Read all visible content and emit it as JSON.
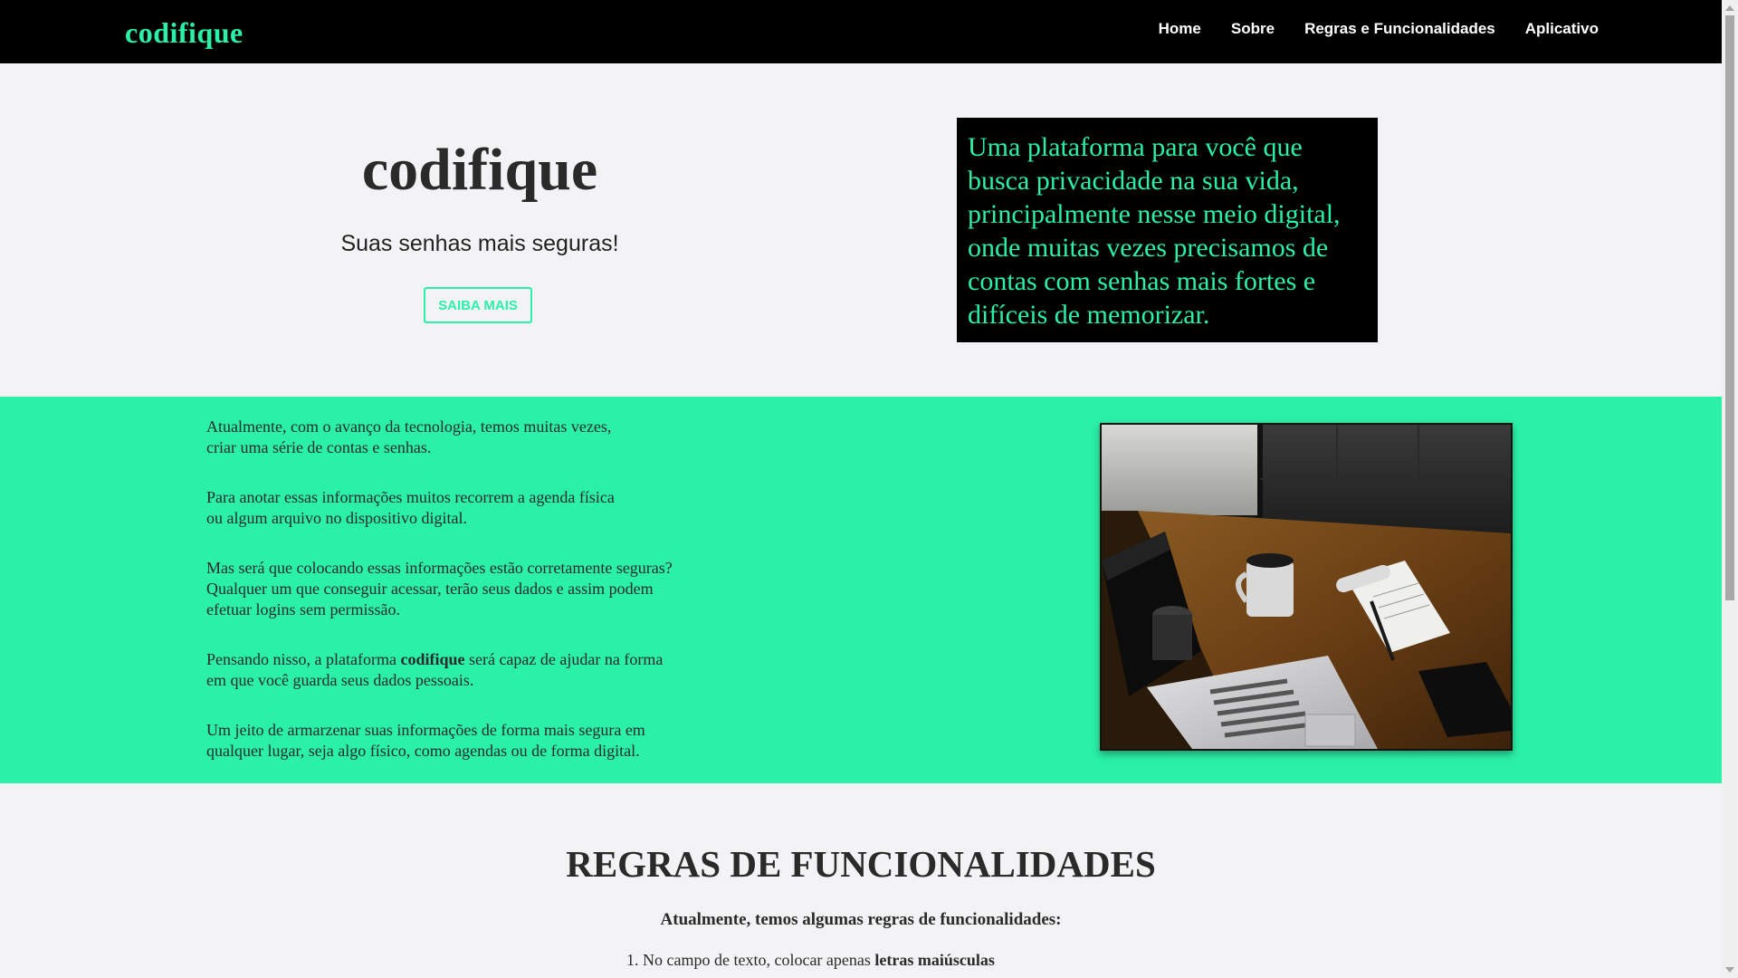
{
  "navbar": {
    "brand": "codifique",
    "links": [
      "Home",
      "Sobre",
      "Regras e Funcionalidades",
      "Aplicativo"
    ]
  },
  "hero": {
    "title": "codifique",
    "subtitle": "Suas senhas mais seguras!",
    "cta_label": "SAIBA MAIS",
    "box_text": "Uma plataforma para você que busca privacidade na sua vida, principalmente nesse meio digital, onde muitas vezes precisamos de contas com senhas mais fortes e difíceis de memorizar."
  },
  "about": {
    "p1_line1": "Atualmente, com o avanço da tecnologia, temos muitas vezes,",
    "p1_line2": "criar uma série de contas e senhas.",
    "p2_line1": "Para anotar essas informações muitos recorrem a agenda física",
    "p2_line2": "ou algum arquivo no dispositivo digital.",
    "p3_line1": "Mas será que colocando essas informações estão corretamente seguras?",
    "p3_line2": "Qualquer um que conseguir acessar, terão seus dados e assim podem",
    "p3_line3": "efetuar logins sem permissão.",
    "p4_pre": "Pensando nisso, a plataforma ",
    "p4_bold": "codifique",
    "p4_post": " será capaz de ajudar na forma",
    "p4_line2": "em que você guarda seus dados pessoais.",
    "p5_line1": "Um jeito de armarzenar suas informações de forma mais segura em",
    "p5_line2": "qualquer lugar, seja algo físico, como agendas ou de forma digital."
  },
  "rules": {
    "title": "REGRAS DE FUNCIONALIDADES",
    "intro": "Atualmente, temos algumas regras de funcionalidades:",
    "item1_pre": "1. No campo de texto, colocar apenas ",
    "item1_bold": "letras maiúsculas"
  },
  "colors": {
    "accent": "#2af0a8",
    "navbar_bg": "#000000",
    "page_bg": "#f3f3f5"
  },
  "icons": {
    "scroll_up": "scroll-up-arrow-icon",
    "scroll_down": "scroll-down-arrow-icon"
  }
}
